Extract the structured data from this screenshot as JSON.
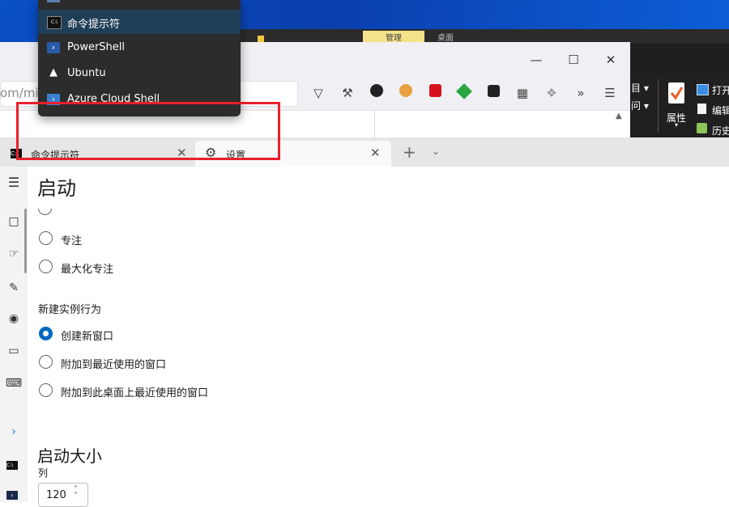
{
  "dropdown": {
    "items": [
      {
        "label": "命令提示符",
        "icon": "cmd-icon",
        "selected": true
      },
      {
        "label": "PowerShell",
        "icon": "powershell-icon"
      },
      {
        "label": "Ubuntu",
        "icon": "ubuntu-icon"
      },
      {
        "label": "Azure Cloud Shell",
        "icon": "azure-icon"
      }
    ]
  },
  "explorer": {
    "tabs": [
      "管理",
      "桌面"
    ],
    "ribbon": {
      "properties": "属性",
      "open": "打开",
      "edit": "编辑",
      "history": "历史",
      "item_label": "目",
      "access_label": "问"
    }
  },
  "browser": {
    "url_partial": "om/micr"
  },
  "terminal": {
    "tabs": [
      {
        "label": "命令提示符",
        "icon": "cmd-icon"
      },
      {
        "label": "设置",
        "icon": "gear-icon",
        "active": true
      }
    ]
  },
  "settings": {
    "page_title": "启动",
    "launch_mode_options": [
      {
        "label": "专注",
        "selected": false
      },
      {
        "label": "最大化专注",
        "selected": false
      }
    ],
    "new_instance_label": "新建实例行为",
    "new_instance_options": [
      {
        "label": "创建新窗口",
        "selected": true
      },
      {
        "label": "附加到最近使用的窗口",
        "selected": false
      },
      {
        "label": "附加到此桌面上最近使用的窗口",
        "selected": false
      }
    ],
    "launch_size_title": "启动大小",
    "columns_label": "列",
    "columns_value": "120"
  },
  "colors": {
    "accent": "#0067c0",
    "highlight": "#e8202a",
    "dropdown_bg": "#2c2c2c"
  }
}
